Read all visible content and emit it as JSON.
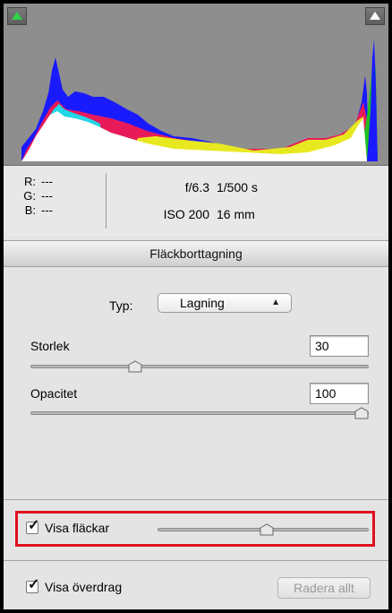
{
  "histogram": {
    "clip_shadow_icon": "triangle-up-green",
    "clip_highlight_icon": "triangle-up-white"
  },
  "readout": {
    "r_label": "R:",
    "r_value": "---",
    "g_label": "G:",
    "g_value": "---",
    "b_label": "B:",
    "b_value": "---"
  },
  "exif": {
    "aperture": "f/6.3",
    "shutter": "1/500 s",
    "iso": "ISO 200",
    "focal": "16 mm"
  },
  "section": {
    "title": "Fläckborttagning"
  },
  "type_row": {
    "label": "Typ:",
    "value": "Lagning"
  },
  "size": {
    "label": "Storlek",
    "value": "30",
    "level": 0.3
  },
  "opacity": {
    "label": "Opacitet",
    "value": "100",
    "level": 1.0
  },
  "visa_flackar": {
    "label": "Visa fläckar",
    "checked": true,
    "level": 0.52
  },
  "visa_overdrag": {
    "label": "Visa överdrag",
    "checked": true
  },
  "clear_button": {
    "label": "Radera allt"
  },
  "colors": {
    "highlight": "#e01020"
  }
}
